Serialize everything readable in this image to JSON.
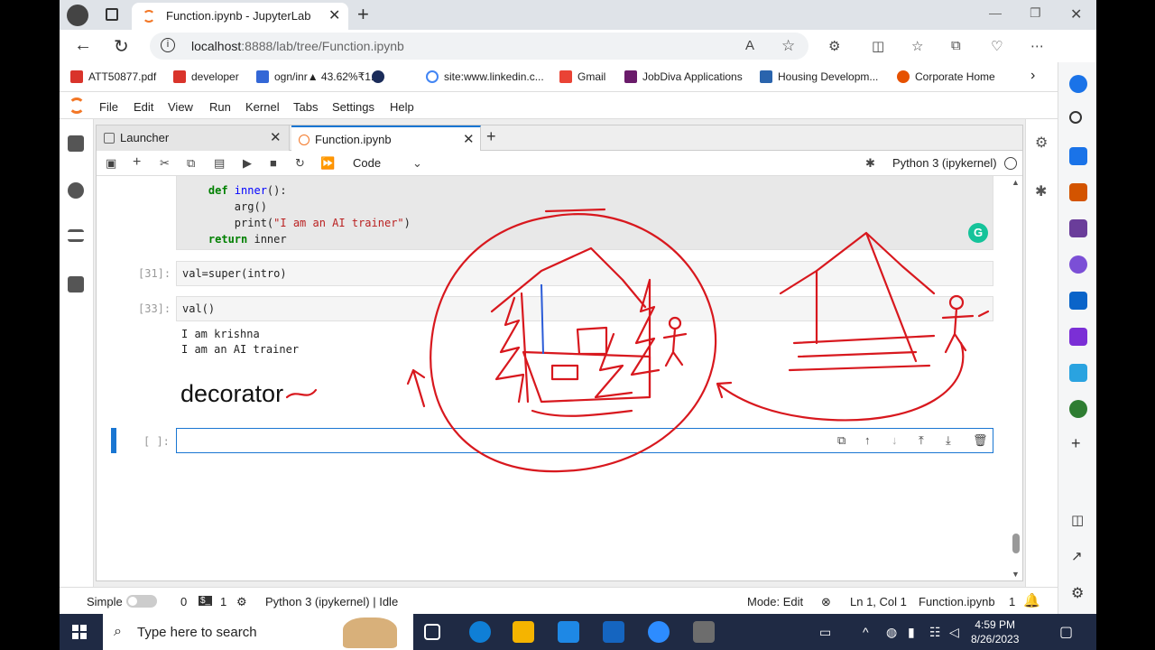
{
  "browser": {
    "tab_title": "Function.ipynb - JupyterLab",
    "url_host": "localhost",
    "url_rest": ":8888/lab/tree/Function.ipynb",
    "bookmarks": [
      "ATT50877.pdf",
      "developer",
      "ogn/inr▲ 43.62%₹1...",
      "site:www.linkedin.c...",
      "Gmail",
      "JobDiva Applications",
      "Housing Developm...",
      "Corporate Home"
    ]
  },
  "jupyter": {
    "menu": [
      "File",
      "Edit",
      "View",
      "Run",
      "Kernel",
      "Tabs",
      "Settings",
      "Help"
    ],
    "tabs": [
      {
        "label": "Launcher"
      },
      {
        "label": "Function.ipynb"
      }
    ],
    "toolbar": {
      "cell_type": "Code",
      "kernel": "Python 3 (ipykernel)"
    },
    "cells": {
      "c1_lines": [
        "    def inner():",
        "        arg()",
        "        print(\"I am an AI trainer\")",
        "    return inner"
      ],
      "c2_prompt": "[31]:",
      "c2_code": "val=super(intro)",
      "c3_prompt": "[33]:",
      "c3_code": "val()",
      "c3_out1": "I am krishna",
      "c3_out2": "I am an AI trainer",
      "md_heading": "decorator",
      "empty_prompt": "[ ]:"
    },
    "status": {
      "simple": "Simple",
      "count0": "0",
      "count1": "1",
      "kernel_status": "Python 3 (ipykernel) | Idle",
      "mode": "Mode: Edit",
      "position": "Ln 1, Col 1",
      "file": "Function.ipynb",
      "notif": "1"
    }
  },
  "taskbar": {
    "search_placeholder": "Type here to search",
    "time": "4:59 PM",
    "date": "8/26/2023"
  },
  "colors": {
    "ink": "#d8181e",
    "accent": "#1976d2",
    "jupyter_orange": "#f37726"
  }
}
